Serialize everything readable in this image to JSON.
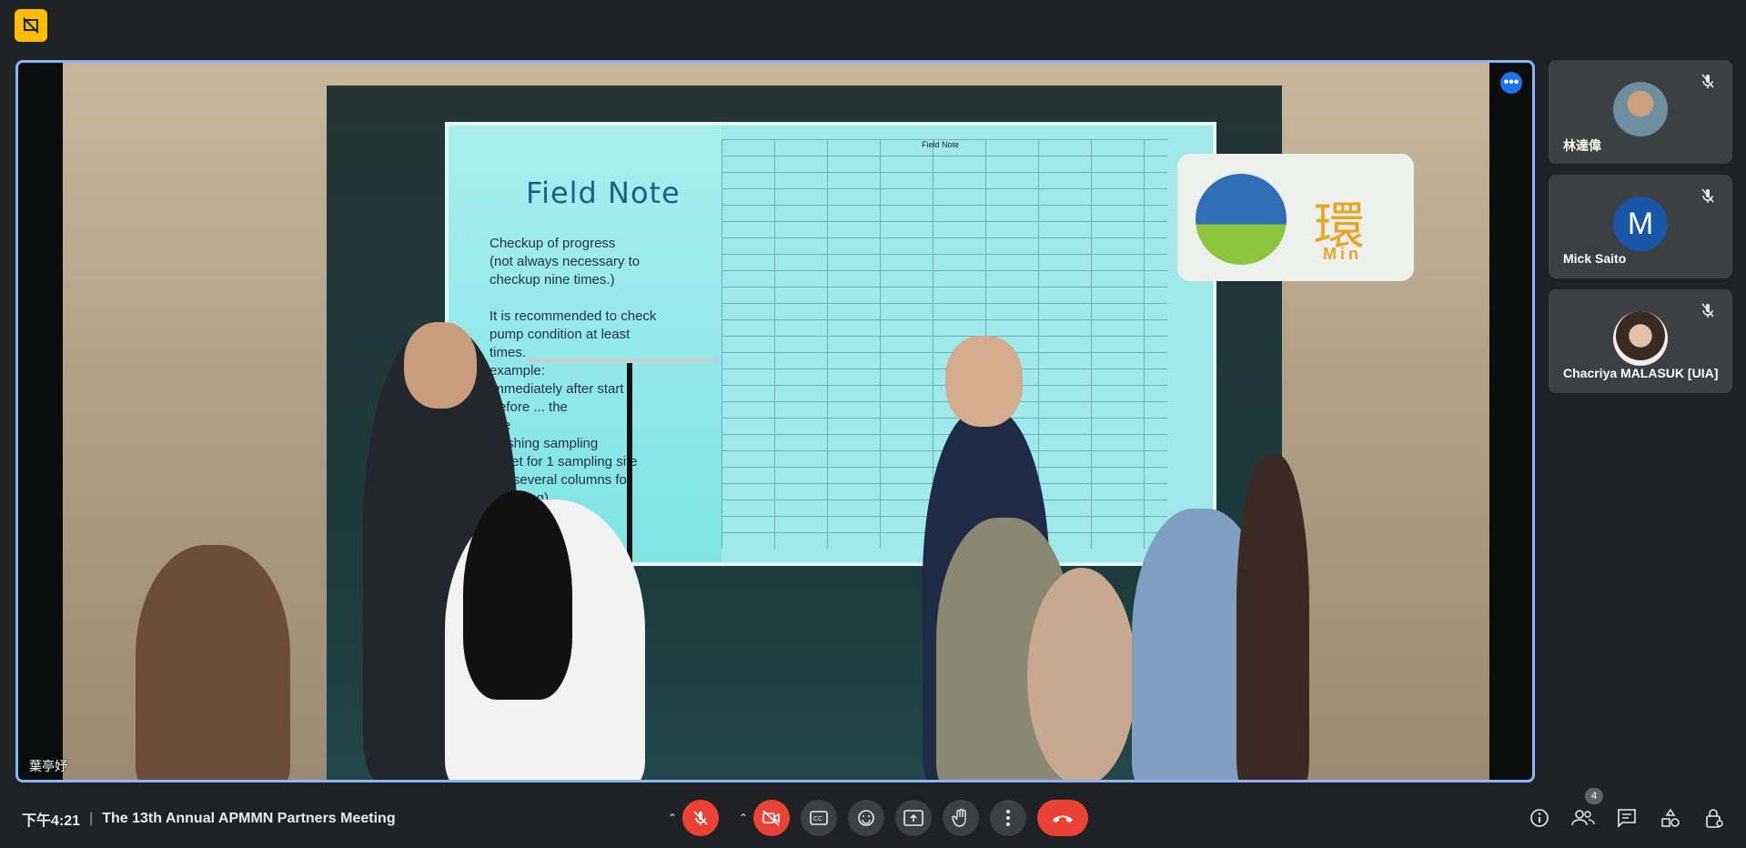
{
  "app": {
    "accent": "#8ab4f8",
    "end_call_color": "#ea4335"
  },
  "main_tile": {
    "speaker_name": "葉亭妤",
    "slide": {
      "title": "Field Note",
      "text_lines": [
        "Checkup of progress",
        "(not always necessary to",
        "checkup nine times.)",
        "It is recommended to check",
        "pump condition at least",
        "times.",
        "example:",
        "immediately after start",
        "Before ... the",
        "site",
        "finishing sampling",
        "sheet for 1 sampling site",
        "are several columns for",
        "sampling)"
      ],
      "table_header": "Field Note"
    },
    "logo_char": "環",
    "logo_sub": "Min"
  },
  "participants": [
    {
      "name": "林達偉",
      "muted": true,
      "avatar_icon": "photo-avatar-icon"
    },
    {
      "name": "Mick Saito",
      "muted": true,
      "avatar_letter": "M"
    },
    {
      "name": "Chacriya MALASUK [UIA]",
      "muted": true,
      "avatar_icon": "photo-avatar-icon"
    }
  ],
  "bottom_bar": {
    "time": "下午4:21",
    "separator": "|",
    "meeting_title": "The 13th Annual APMMN Partners Meeting",
    "participant_count": "4"
  },
  "controls": {
    "mic": "mic-off-icon",
    "camera": "camera-off-icon",
    "captions": "captions-icon",
    "reactions": "emoji-icon",
    "present": "present-screen-icon",
    "raise_hand": "raise-hand-icon",
    "more": "more-vert-icon",
    "end_call": "end-call-icon"
  },
  "right_controls": [
    "info-icon",
    "people-icon",
    "chat-icon",
    "activities-icon",
    "host-controls-icon"
  ]
}
